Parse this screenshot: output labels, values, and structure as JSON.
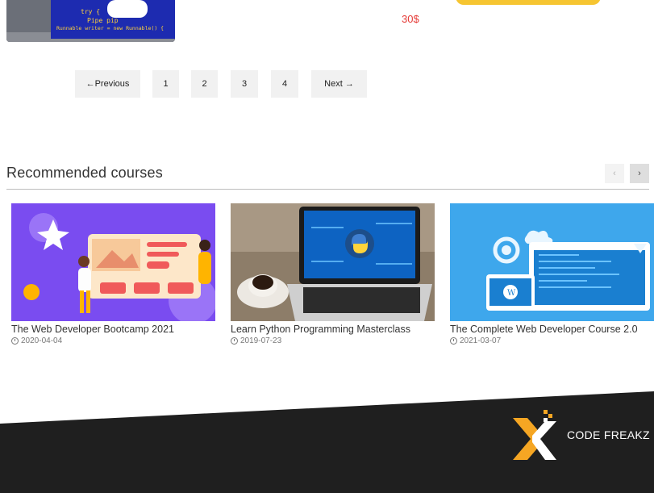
{
  "top": {
    "price": "30$",
    "thumb_code_lines": [
      "try {",
      "Pipe pip",
      "Runnable writer = new Runnable() {"
    ]
  },
  "pagination": {
    "prev_label": "←Previous",
    "pages": [
      "1",
      "2",
      "3",
      "4"
    ],
    "next_label": "Next →"
  },
  "recommended": {
    "title": "Recommended courses",
    "prev_arrow": "‹",
    "next_arrow": "›",
    "courses": [
      {
        "title": "The Web Developer Bootcamp 2021",
        "date": "2020-04-04",
        "image_icon": "web-design-illustration-icon"
      },
      {
        "title": "Learn Python Programming Masterclass",
        "date": "2019-07-23",
        "image_icon": "python-laptop-icon"
      },
      {
        "title": "The Complete Web Developer Course 2.0",
        "date": "2021-03-07",
        "image_icon": "web-devices-illustration-icon"
      }
    ]
  },
  "footer": {
    "brand": "CODE FREAKZ",
    "logo_icon": "code-freakz-logo-icon",
    "colors": {
      "background": "#1f1f1f",
      "logo_orange": "#f5a623",
      "logo_white": "#ffffff"
    }
  },
  "colors": {
    "price": "#e53935",
    "button_yellow": "#f6c531",
    "pager_bg": "#f1f1f1"
  }
}
